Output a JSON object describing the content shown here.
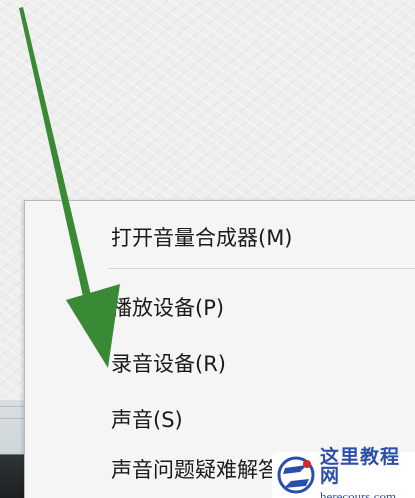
{
  "context_menu": {
    "items": [
      {
        "label": "打开音量合成器(M)"
      },
      {
        "label": "播放设备(P)"
      },
      {
        "label": "录音设备(R)"
      },
      {
        "label": "声音(S)"
      },
      {
        "label": "声音问题疑难解答(T)"
      }
    ]
  },
  "annotation": {
    "arrow_color": "#3a8a35",
    "icon": "green-arrow-icon"
  },
  "watermark": {
    "title": "这里教程网",
    "url": "herecours.com",
    "logo_icon": "z-logo-icon"
  },
  "colors": {
    "menu_background": "#f5f5f5",
    "menu_text": "#1a1a1a",
    "watermark_text": "#2a4fa8"
  }
}
